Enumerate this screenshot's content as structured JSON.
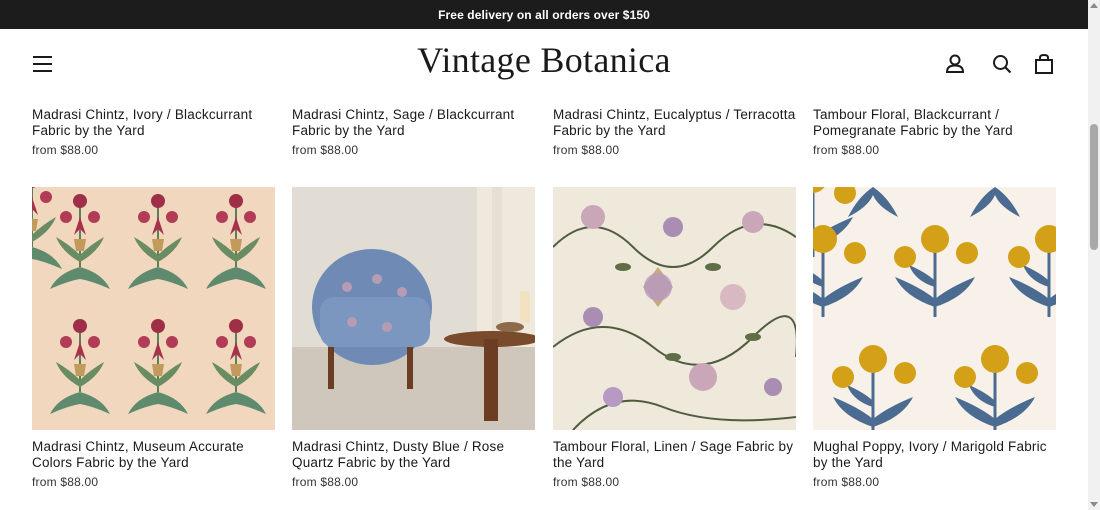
{
  "announcement": "Free delivery on all orders over $150",
  "header": {
    "logo": "Vintage Botanica",
    "icons": [
      "menu-icon",
      "account-icon",
      "search-icon",
      "cart-icon"
    ]
  },
  "row1": [
    {
      "title": "Madrasi Chintz, Ivory / Blackcurrant Fabric by the Yard",
      "price": "from $88.00"
    },
    {
      "title": "Madrasi Chintz, Sage / Blackcurrant Fabric by the Yard",
      "price": "from $88.00"
    },
    {
      "title": "Madrasi Chintz, Eucalyptus / Terracotta Fabric by the Yard",
      "price": "from $88.00"
    },
    {
      "title": "Tambour Floral, Blackcurrant / Pomegranate Fabric by the Yard",
      "price": "from $88.00"
    }
  ],
  "row2": [
    {
      "title": "Madrasi Chintz, Museum Accurate Colors Fabric by the Yard",
      "price": "from $88.00"
    },
    {
      "title": "Madrasi Chintz, Dusty Blue / Rose Quartz Fabric by the Yard",
      "price": "from $88.00"
    },
    {
      "title": "Tambour Floral, Linen / Sage Fabric by the Yard",
      "price": "from $88.00"
    },
    {
      "title": "Mughal Poppy, Ivory / Marigold Fabric by the Yard",
      "price": "from $88.00"
    }
  ],
  "colors": {
    "announcement_bg": "#1c1c1c",
    "chintz_bg": "#f0d7bd",
    "poppy_yellow": "#d4a017",
    "poppy_blue": "#4b6b91"
  }
}
